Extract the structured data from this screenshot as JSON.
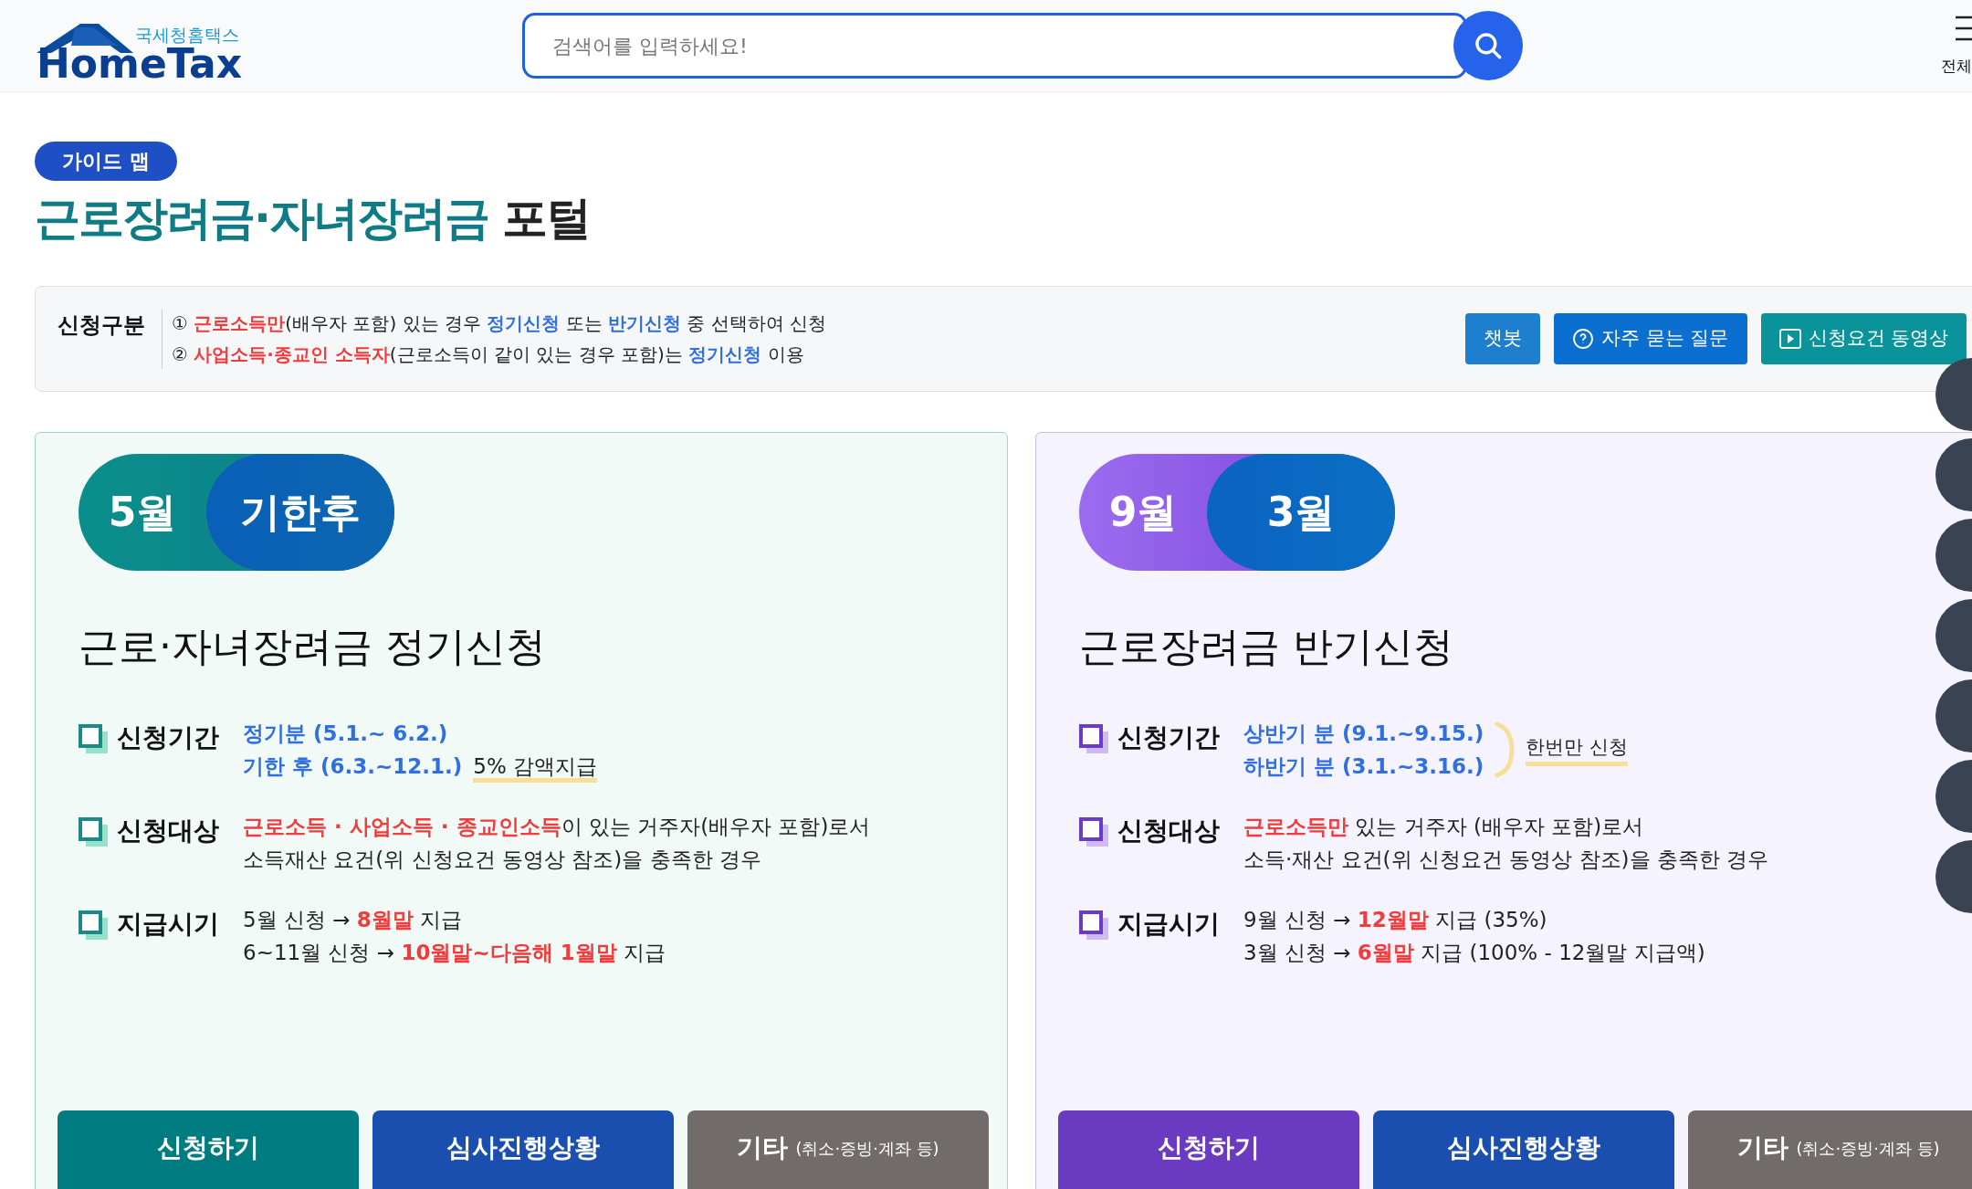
{
  "header": {
    "logo_small": "국세청홈택스",
    "logo_big": "HomeTax",
    "search": {
      "placeholder": "검색어를 입력하세요!"
    },
    "menu_label": "전체"
  },
  "badge": "가이드 맵",
  "title": {
    "accent": "근로장려금·자녀장려금",
    "rest": "포털"
  },
  "intro": {
    "label": "신청구분",
    "lines": [
      [
        {
          "t": "① ",
          "kind": "plain"
        },
        {
          "t": "근로소득만",
          "kind": "red"
        },
        {
          "t": "(배우자 포함) 있는 경우 ",
          "kind": "plain"
        },
        {
          "t": "정기신청",
          "kind": "blue"
        },
        {
          "t": " 또는 ",
          "kind": "plain"
        },
        {
          "t": "반기신청",
          "kind": "blue"
        },
        {
          "t": " 중 선택하여 신청",
          "kind": "plain"
        }
      ],
      [
        {
          "t": "② ",
          "kind": "plain"
        },
        {
          "t": "사업소득·종교인 소득자",
          "kind": "red"
        },
        {
          "t": "(근로소득이 같이 있는 경우 포함)는 ",
          "kind": "plain"
        },
        {
          "t": "정기신청",
          "kind": "blue"
        },
        {
          "t": " 이용",
          "kind": "plain"
        }
      ]
    ],
    "buttons": [
      {
        "label": "챗봇",
        "kind": "plain"
      },
      {
        "label": "자주 묻는 질문",
        "kind": "faq"
      },
      {
        "label": "신청요건 동영상",
        "kind": "video"
      }
    ]
  },
  "cards": [
    {
      "kind": "teal",
      "pill": [
        "5월",
        "기한후"
      ],
      "title": "근로·자녀장려금 정기신청",
      "rows": [
        {
          "label": "신청기간",
          "lines": [
            [
              {
                "t": "정기분 (5.1.~ 6.2.)",
                "kind": "blue"
              }
            ],
            [
              {
                "t": "기한 후 (6.3.~12.1.)",
                "kind": "blue"
              },
              {
                "t": "5% 감액지급",
                "kind": "highlight"
              }
            ]
          ]
        },
        {
          "label": "신청대상",
          "lines": [
            [
              {
                "t": "근로소득 · 사업소득 · 종교인소득",
                "kind": "red"
              },
              {
                "t": "이 있는 거주자(배우자 포함)로서",
                "kind": "plain"
              }
            ],
            [
              {
                "t": "소득재산 요건(위 신청요건 동영상 참조)을 충족한 경우",
                "kind": "plain"
              }
            ]
          ]
        },
        {
          "label": "지급시기",
          "lines": [
            [
              {
                "t": "5월 신청 → ",
                "kind": "plain"
              },
              {
                "t": "8월말",
                "kind": "red"
              },
              {
                "t": " 지급",
                "kind": "plain"
              }
            ],
            [
              {
                "t": "6~11월 신청 → ",
                "kind": "plain"
              },
              {
                "t": "10월말~다음해 1월말",
                "kind": "red"
              },
              {
                "t": " 지급",
                "kind": "plain"
              }
            ]
          ]
        }
      ],
      "buttons": [
        {
          "label": "신청하기",
          "kind": "apply"
        },
        {
          "label": "심사진행상황",
          "kind": "status"
        },
        {
          "label": "기타",
          "sub": "(취소·증빙·계좌 등)",
          "kind": "other"
        }
      ]
    },
    {
      "kind": "purple",
      "pill": [
        "9월",
        "3월"
      ],
      "title": "근로장려금 반기신청",
      "rows": [
        {
          "label": "신청기간",
          "lines": [
            [
              {
                "t": "상반기 분 (9.1.~9.15.)",
                "kind": "blue"
              }
            ],
            [
              {
                "t": "하반기 분 (3.1.~3.16.)",
                "kind": "blue"
              }
            ]
          ],
          "bracket_note": "한번만 신청"
        },
        {
          "label": "신청대상",
          "lines": [
            [
              {
                "t": "근로소득만",
                "kind": "red"
              },
              {
                "t": " 있는 거주자 (배우자 포함)로서",
                "kind": "plain"
              }
            ],
            [
              {
                "t": "소득·재산 요건(위 신청요건 동영상 참조)을 충족한 경우",
                "kind": "plain"
              }
            ]
          ]
        },
        {
          "label": "지급시기",
          "lines": [
            [
              {
                "t": "9월 신청 → ",
                "kind": "plain"
              },
              {
                "t": "12월말",
                "kind": "red"
              },
              {
                "t": " 지급 (35%)",
                "kind": "plain"
              }
            ],
            [
              {
                "t": "3월 신청 → ",
                "kind": "plain"
              },
              {
                "t": "6월말",
                "kind": "red"
              },
              {
                "t": " 지급 (100% - 12월말 지급액)",
                "kind": "plain"
              }
            ]
          ]
        }
      ],
      "buttons": [
        {
          "label": "신청하기",
          "kind": "apply"
        },
        {
          "label": "심사진행상황",
          "kind": "status"
        },
        {
          "label": "기타",
          "sub": "(취소·증빙·계좌 등)",
          "kind": "other"
        }
      ]
    }
  ]
}
